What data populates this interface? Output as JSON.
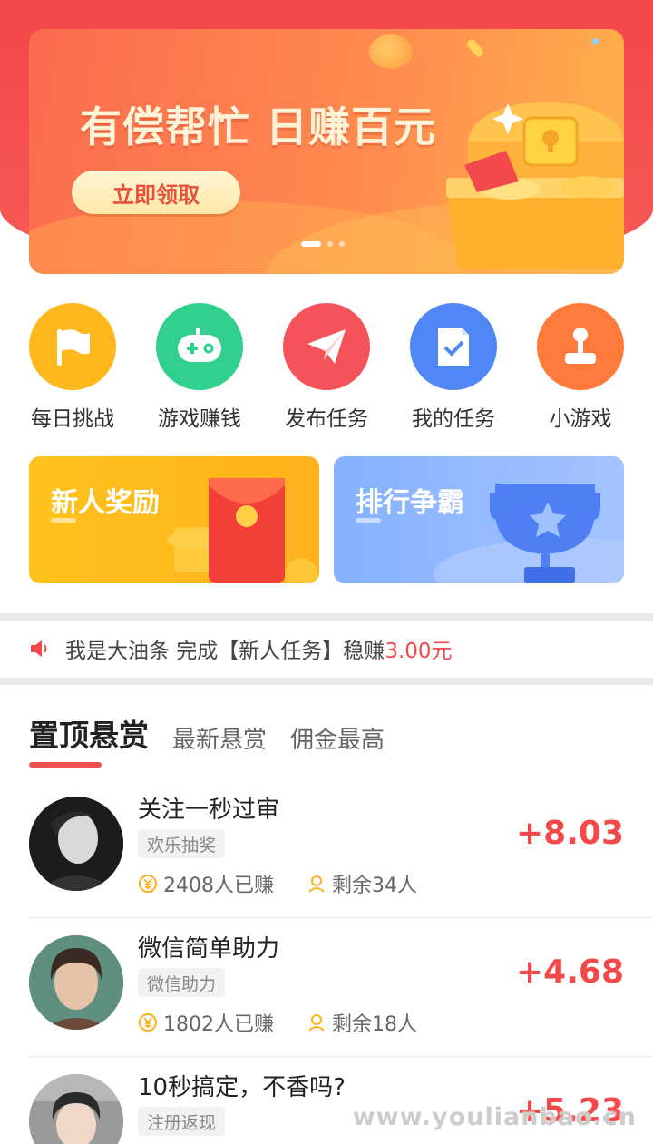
{
  "banner": {
    "title": "有偿帮忙 日赚百元",
    "button_label": "立即领取"
  },
  "categories": [
    {
      "label": "每日挑战",
      "icon": "flag-icon",
      "color": "#ffb81c"
    },
    {
      "label": "游戏赚钱",
      "icon": "gamepad-icon",
      "color": "#31d08e"
    },
    {
      "label": "发布任务",
      "icon": "paper-plane-icon",
      "color": "#f4535a"
    },
    {
      "label": "我的任务",
      "icon": "checklist-icon",
      "color": "#4f87f6"
    },
    {
      "label": "小游戏",
      "icon": "joystick-icon",
      "color": "#ff7a3b"
    }
  ],
  "promos": [
    {
      "title": "新人奖励",
      "icon": "red-envelope-icon"
    },
    {
      "title": "排行争霸",
      "icon": "trophy-icon"
    }
  ],
  "notice": {
    "text": "我是大油条 完成【新人任务】稳赚",
    "amount": "3.00元",
    "icon": "speaker-icon"
  },
  "tabs": [
    {
      "label": "置顶悬赏"
    },
    {
      "label": "最新悬赏"
    },
    {
      "label": "佣金最高"
    }
  ],
  "tasks": [
    {
      "title": "关注一秒过审",
      "tag": "欢乐抽奖",
      "earned": "2408人已赚",
      "remaining": "剩余34人",
      "price": "+8.03"
    },
    {
      "title": "微信简单助力",
      "tag": "微信助力",
      "earned": "1802人已赚",
      "remaining": "剩余18人",
      "price": "+4.68"
    },
    {
      "title": "10秒搞定，不香吗?",
      "tag": "注册返现",
      "earned": "",
      "remaining": "",
      "price": "+5.23"
    }
  ],
  "watermark": "www.youlianbao.cn"
}
